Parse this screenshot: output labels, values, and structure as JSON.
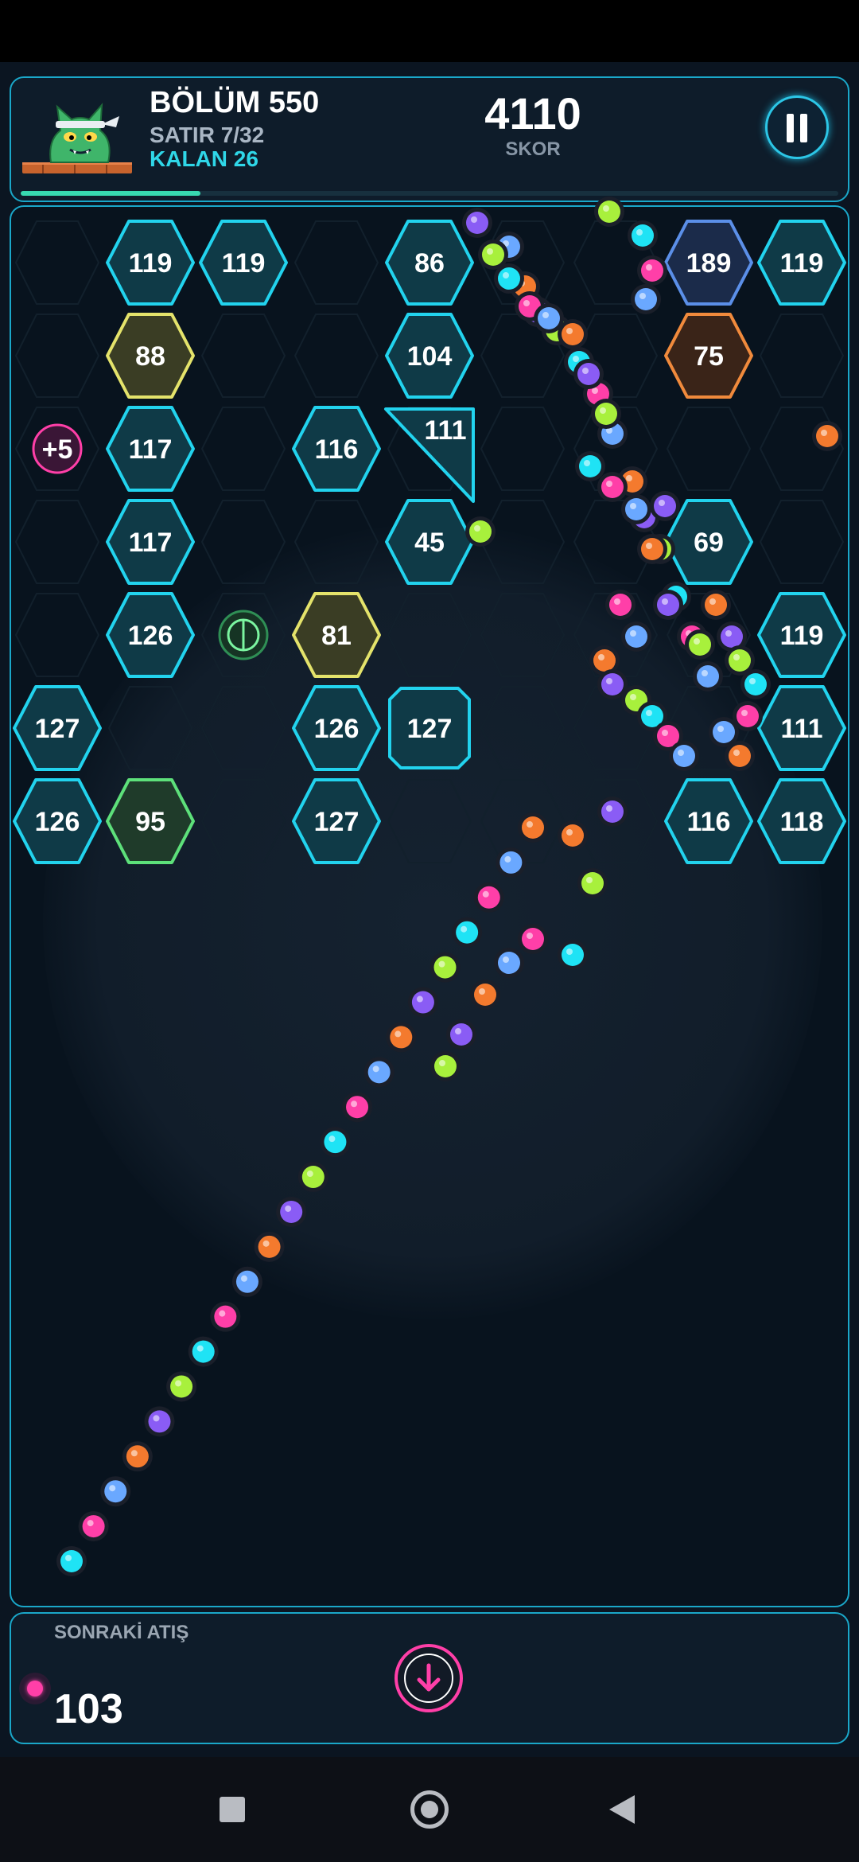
{
  "header": {
    "level": "BÖLÜM 550",
    "rows": "SATIR 7/32",
    "remaining": "KALAN 26",
    "score": "4110",
    "score_label": "SKOR",
    "row_progress": 0.22
  },
  "icons": {
    "pause": "pause-icon",
    "mascot": "green-cat-mascot-icon",
    "fire": "down-arrow-icon"
  },
  "colors": {
    "accent": "#1aa7c9",
    "cyan_block": "#22d3ee",
    "yellow_block": "#e4e36b",
    "green_block": "#5de07a",
    "orange_block": "#f08a3c",
    "blue_block": "#5b8fe8",
    "ball_palette": [
      "#1fe3f5",
      "#ff3fa8",
      "#6aa8ff",
      "#f47a2e",
      "#8a5cf5",
      "#a8f03c"
    ]
  },
  "blocks": [
    {
      "value": "119",
      "style": "cyan",
      "row": 0,
      "col": 1
    },
    {
      "value": "119",
      "style": "cyan",
      "row": 0,
      "col": 2
    },
    {
      "value": "86",
      "style": "cyan",
      "row": 0,
      "col": 4
    },
    {
      "value": "189",
      "style": "blue",
      "row": 0,
      "col": 7
    },
    {
      "value": "119",
      "style": "cyan",
      "row": 0,
      "col": 8
    },
    {
      "value": "88",
      "style": "yellow",
      "row": 1,
      "col": 1
    },
    {
      "value": "104",
      "style": "cyan",
      "row": 1,
      "col": 4
    },
    {
      "value": "75",
      "style": "orange",
      "row": 1,
      "col": 7
    },
    {
      "value": "117",
      "style": "cyan",
      "row": 2,
      "col": 1
    },
    {
      "value": "116",
      "style": "cyan",
      "row": 2,
      "col": 3
    },
    {
      "value": "111",
      "style": "triangle",
      "row": 2,
      "col": 4
    },
    {
      "value": "117",
      "style": "cyan",
      "row": 3,
      "col": 1
    },
    {
      "value": "45",
      "style": "cyan",
      "row": 3,
      "col": 4
    },
    {
      "value": "69",
      "style": "cyan",
      "row": 3,
      "col": 7
    },
    {
      "value": "126",
      "style": "cyan",
      "row": 4,
      "col": 1
    },
    {
      "value": "81",
      "style": "yellow",
      "row": 4,
      "col": 3
    },
    {
      "value": "119",
      "style": "cyan",
      "row": 4,
      "col": 8
    },
    {
      "value": "127",
      "style": "cyan",
      "row": 5,
      "col": 0
    },
    {
      "value": "126",
      "style": "cyan",
      "row": 5,
      "col": 3
    },
    {
      "value": "127",
      "style": "octagon",
      "row": 5,
      "col": 4
    },
    {
      "value": "111",
      "style": "cyan",
      "row": 5,
      "col": 8
    },
    {
      "value": "126",
      "style": "cyan",
      "row": 6,
      "col": 0
    },
    {
      "value": "95",
      "style": "green",
      "row": 6,
      "col": 1
    },
    {
      "value": "127",
      "style": "cyan",
      "row": 6,
      "col": 3
    },
    {
      "value": "116",
      "style": "cyan",
      "row": 6,
      "col": 7
    },
    {
      "value": "118",
      "style": "cyan",
      "row": 6,
      "col": 8
    }
  ],
  "powerups": [
    {
      "label": "+5",
      "type": "extra-balls",
      "row": 2,
      "col": 0
    },
    {
      "type": "laser-vertical",
      "row": 4,
      "col": 2
    }
  ],
  "footer": {
    "next_label": "SONRAKİ ATIŞ",
    "ball_count": "103"
  }
}
